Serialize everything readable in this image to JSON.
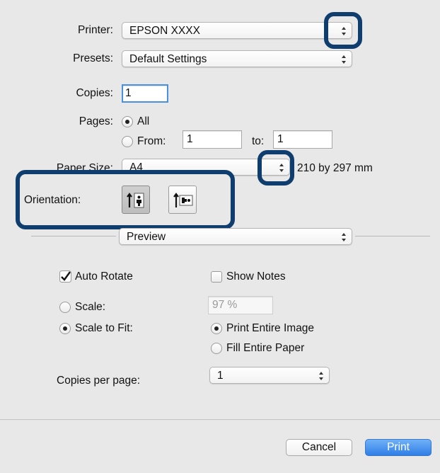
{
  "printer": {
    "label": "Printer:",
    "value": "EPSON XXXX"
  },
  "presets": {
    "label": "Presets:",
    "value": "Default Settings"
  },
  "copies": {
    "label": "Copies:",
    "value": "1"
  },
  "pages": {
    "label": "Pages:",
    "all_label": "All",
    "from_label": "From:",
    "from_value": "1",
    "to_label": "to:",
    "to_value": "1"
  },
  "paper_size": {
    "label": "Paper Size:",
    "value": "A4",
    "dimensions": "210 by 297 mm"
  },
  "orientation": {
    "label": "Orientation:",
    "selected": "portrait"
  },
  "section_popup": {
    "value": "Preview"
  },
  "preview": {
    "auto_rotate_label": "Auto Rotate",
    "auto_rotate_checked": true,
    "show_notes_label": "Show Notes",
    "show_notes_checked": false,
    "scale_label": "Scale:",
    "scale_value": "97 %",
    "scale_to_fit_label": "Scale to Fit:",
    "print_entire_image_label": "Print Entire Image",
    "fill_entire_paper_label": "Fill Entire Paper",
    "copies_per_page_label": "Copies per page:",
    "copies_per_page_value": "1"
  },
  "buttons": {
    "cancel": "Cancel",
    "print": "Print"
  },
  "colors": {
    "highlight": "#0f3d6e",
    "accent": "#2f7ee6",
    "background": "#e8e8e8"
  }
}
